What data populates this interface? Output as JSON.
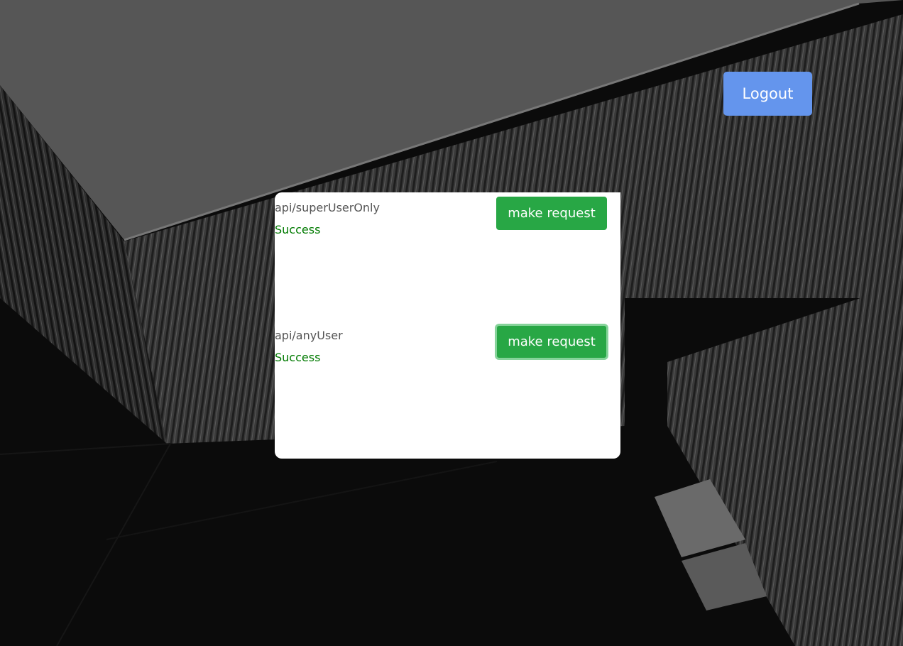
{
  "colors": {
    "logout_bg": "#6495ed",
    "request_bg": "#28a745",
    "success_text": "#007a00"
  },
  "header": {
    "logout_label": "Logout"
  },
  "endpoints": [
    {
      "path": "api/superUserOnly",
      "status": "Success",
      "button_label": "make request",
      "focused": false
    },
    {
      "path": "api/anyUser",
      "status": "Success",
      "button_label": "make request",
      "focused": true
    }
  ]
}
